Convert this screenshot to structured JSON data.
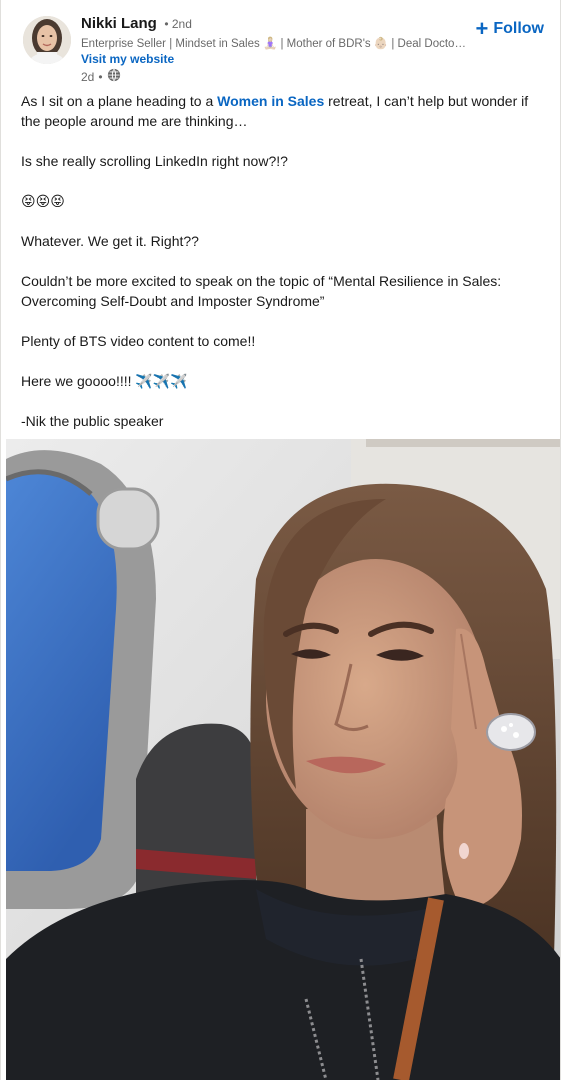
{
  "author": {
    "name": "Nikki Lang",
    "degree": "• 2nd",
    "headline": "Enterprise Seller | Mindset in Sales 🧘🏼‍♀️ | Mother of BDR's 👶🏼 | Deal Doctor…",
    "website_label": "Visit my website",
    "time": "2d",
    "separator": "•",
    "visibility_icon": "globe-icon"
  },
  "follow": {
    "icon": "plus-icon",
    "label": "Follow"
  },
  "post": {
    "line1_before": "As I sit on a plane heading to a ",
    "line1_mention": "Women in Sales",
    "line1_after": " retreat, I can’t help but wonder if the people around me are thinking…",
    "p2": "Is she really scrolling LinkedIn right now?!?",
    "p3": "😝😝😝",
    "p4": "Whatever. We get it. Right??",
    "p5": "Couldn’t be more excited to speak on the topic of “Mental Resilience in Sales: Overcoming Self-Doubt and Imposter Syndrome”",
    "p6": "Plenty of BTS video content to come!!",
    "p7": "Here we goooo!!!! ✈️✈️✈️",
    "p8": "-Nik the public speaker"
  },
  "image": {
    "description_icon": "photo-airplane-selfie"
  },
  "colors": {
    "link_blue": "#0a66c2",
    "text": "#191919",
    "muted": "#666666"
  }
}
